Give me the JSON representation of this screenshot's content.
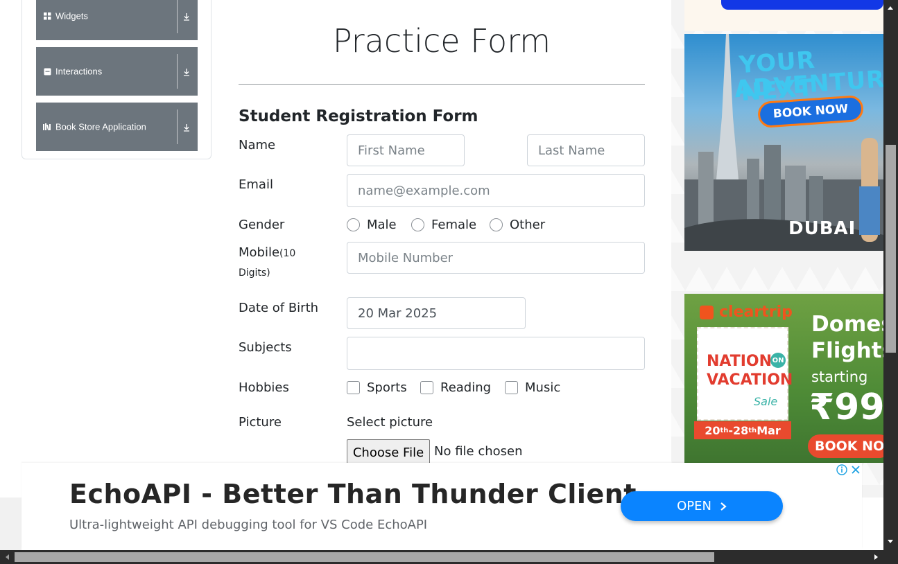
{
  "sidebar": {
    "groups": [
      {
        "label": "Widgets",
        "icon": "grid-icon"
      },
      {
        "label": "Interactions",
        "icon": "interactions-icon"
      },
      {
        "label": "Book Store Application",
        "icon": "book-icon"
      }
    ]
  },
  "form": {
    "page_title": "Practice Form",
    "heading": "Student Registration Form",
    "name_label": "Name",
    "first_name_placeholder": "First Name",
    "last_name_placeholder": "Last Name",
    "email_label": "Email",
    "email_placeholder": "name@example.com",
    "gender_label": "Gender",
    "gender_options": [
      "Male",
      "Female",
      "Other"
    ],
    "mobile_label": "Mobile",
    "mobile_hint_1": "(10",
    "mobile_hint_2": "Digits)",
    "mobile_placeholder": "Mobile Number",
    "dob_label": "Date of Birth",
    "dob_value": "20 Mar 2025",
    "subjects_label": "Subjects",
    "subjects_value": "",
    "hobbies_label": "Hobbies",
    "hobby_options": [
      "Sports",
      "Reading",
      "Music"
    ],
    "picture_label": "Picture",
    "select_picture_label": "Select picture",
    "choose_file_label": "Choose File",
    "no_file_text": "No file chosen"
  },
  "ads": {
    "ad1": {
      "line1": "YOUR NEXT",
      "line2": "ADVENTURE",
      "cta": "BOOK NOW",
      "brand": "DUBAI"
    },
    "ad2": {
      "brand": "cleartrip",
      "nation": "NATION",
      "on": "ON",
      "vacation": "VACATION",
      "sale": "Sale",
      "dates_a": "20",
      "dates_sup_a": "th",
      "dates_b": "-28",
      "dates_sup_b": "th",
      "dates_c": " Mar",
      "headline1": "Domes",
      "headline2": "Flights",
      "starting": "starting",
      "price": "₹99",
      "cta": "BOOK NO"
    }
  },
  "banner": {
    "title": "EchoAPI - Better Than Thunder Client",
    "subtitle": "Ultra-lightweight API debugging tool for VS Code EchoAPI",
    "open_label": "OPEN"
  },
  "colors": {
    "sidebar_group": "#6c757d",
    "open_button": "#0a84ff",
    "scrollbar": "#2c2c2c"
  }
}
